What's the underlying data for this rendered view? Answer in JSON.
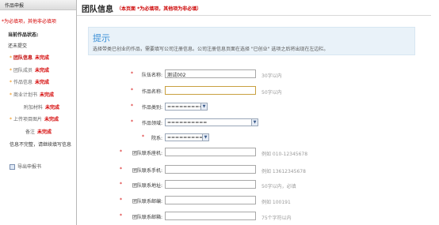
{
  "sidebar": {
    "header": "作品申报",
    "note": "*为必填项，其他非必填项",
    "status_label": "当前作品状态:",
    "status_value": "还未提交",
    "items": [
      {
        "star": "*",
        "label": "团队信息",
        "state": "未完成",
        "current": true
      },
      {
        "star": "*",
        "label": "团队成员",
        "state": "未完成",
        "current": false
      },
      {
        "star": "*",
        "label": "作品信息",
        "state": "未完成",
        "current": false
      },
      {
        "star": "*",
        "label": "商业计划书",
        "state": "未完成",
        "current": false
      },
      {
        "star": "",
        "label": "附加材料",
        "state": "未完成",
        "current": false
      },
      {
        "star": "*",
        "label": "上传项目图片",
        "state": "未完成",
        "current": false
      },
      {
        "star": "",
        "label": "备注",
        "state": "未完成",
        "current": false
      }
    ],
    "warning": "信息不完整，请继续填写信息",
    "export_label": "导出申报书"
  },
  "main": {
    "title": "团队信息",
    "title_note": "（本页面 *为必填项，其他项为非必填）",
    "tip_title": "提示",
    "tip_text": "选择带类已创业的作品，需要填写公司注册信息。公司注册信息页面在选择 \"已创业\" 选项之后将出现在左边栏。"
  },
  "form": {
    "team_name": {
      "label": "队伍名称:",
      "value": "测试002",
      "hint": "30字以内",
      "required": true
    },
    "work_name": {
      "label": "作品名称:",
      "value": "",
      "hint": "50字以内",
      "required": true
    },
    "work_category": {
      "label": "作品类别:",
      "value": "==========",
      "required": true
    },
    "work_field": {
      "label": "作品领域:",
      "value": "==========",
      "required": true
    },
    "college": {
      "label": "院系:",
      "value": "==========",
      "required": true
    },
    "contact_phone": {
      "label": "团队联系座机:",
      "value": "",
      "hint": "例如 010-12345678",
      "required": true
    },
    "contact_mobile": {
      "label": "团队联系手机:",
      "value": "",
      "hint": "例如 13612345678",
      "required": true
    },
    "contact_address": {
      "label": "团队联系地址:",
      "value": "",
      "hint": "50字以内，必填",
      "required": true
    },
    "contact_postcode": {
      "label": "团队联系邮编:",
      "value": "",
      "hint": "例如 100191",
      "required": true
    },
    "contact_email": {
      "label": "团队联系邮箱:",
      "value": "",
      "hint": "75个字符以内",
      "required": true
    }
  },
  "colors": {
    "required": "#d40000",
    "accent": "#3a8fd6",
    "tip_bg": "#e9f2f9"
  }
}
